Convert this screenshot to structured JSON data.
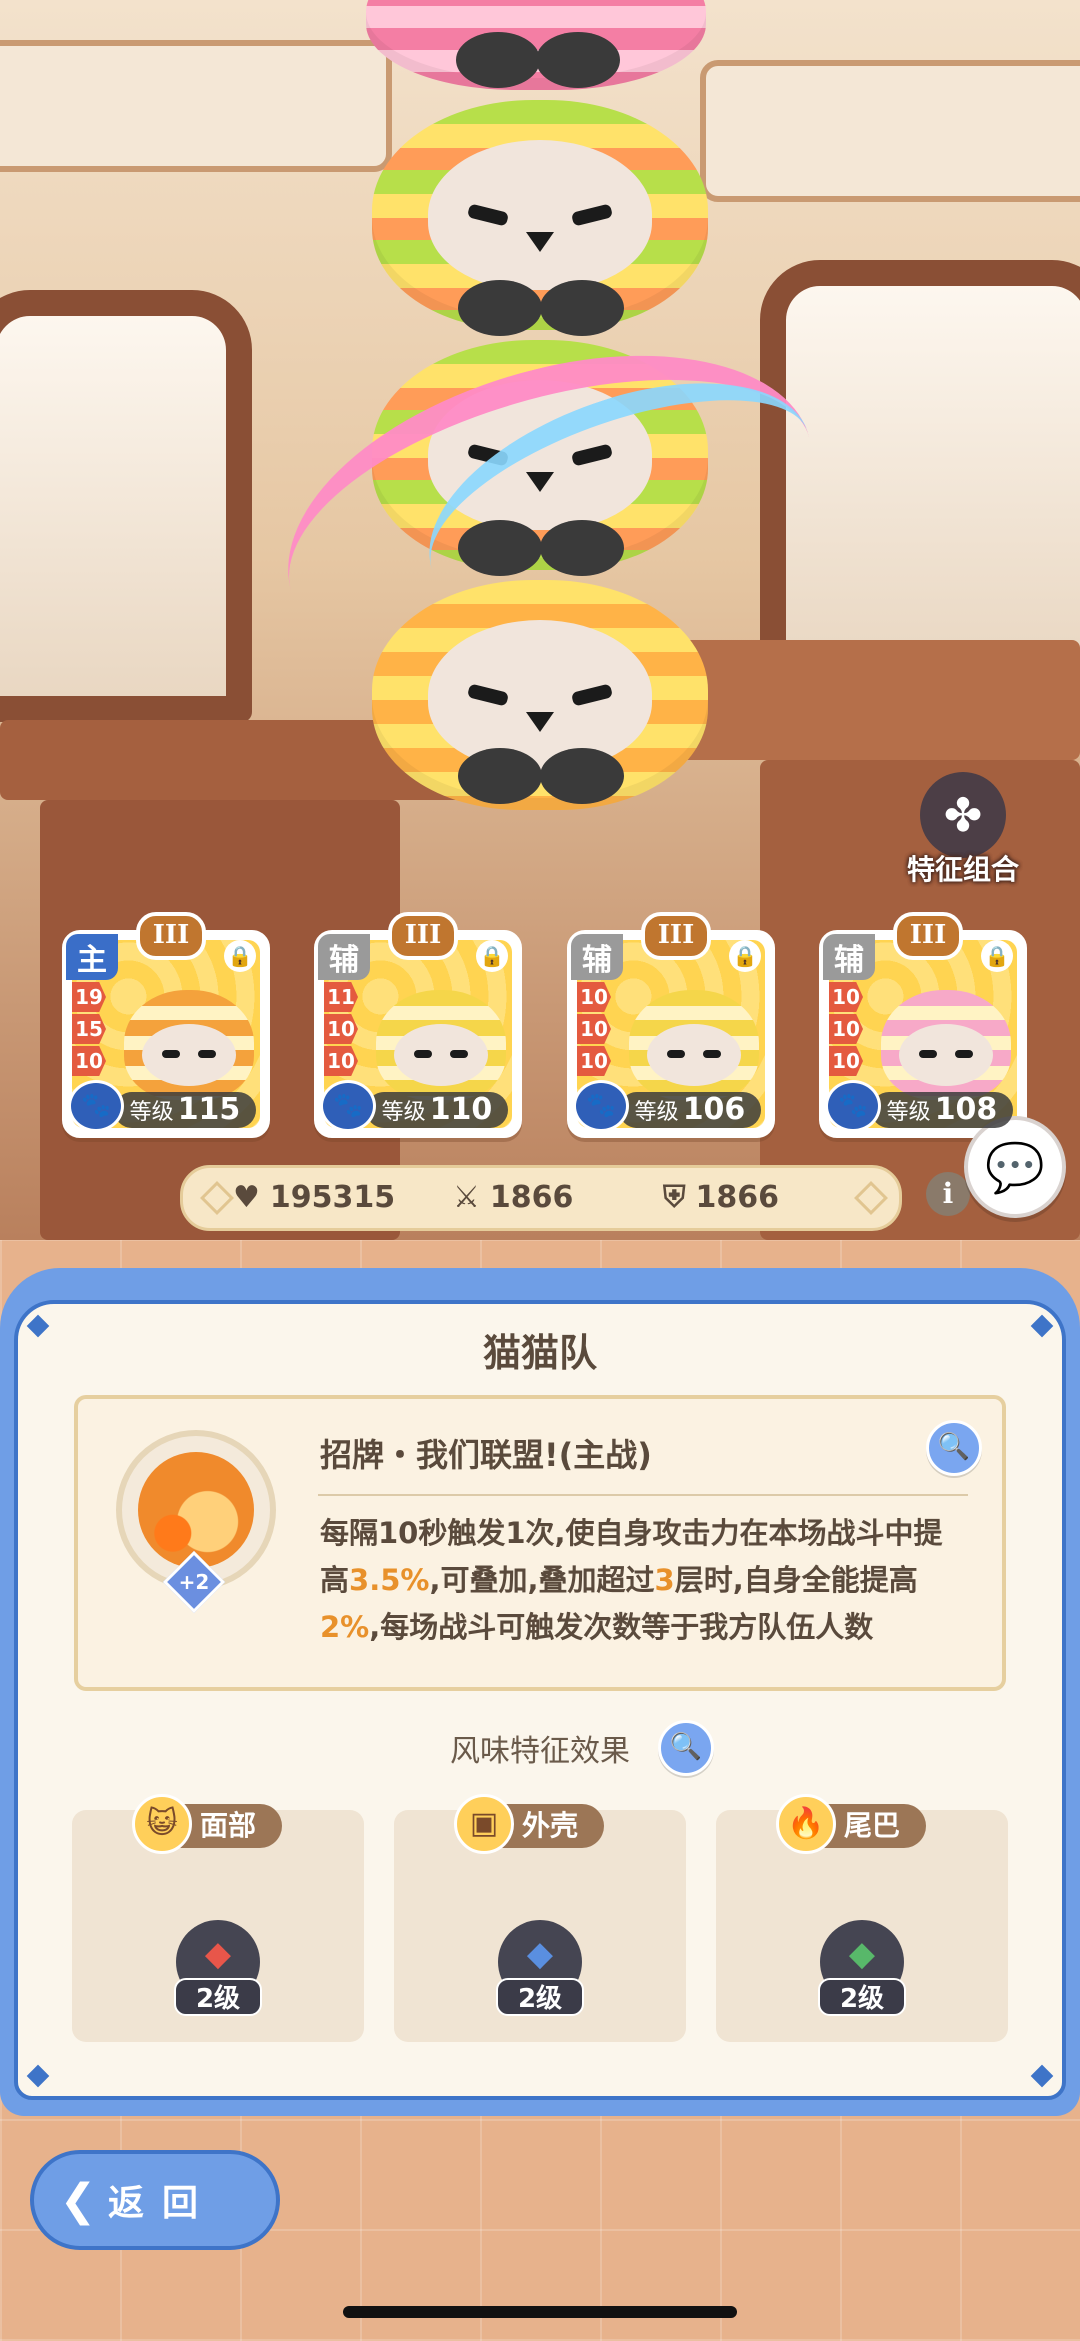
{
  "trait_combo": {
    "label": "特征组合",
    "icon": "clover-icon"
  },
  "cards": [
    {
      "role": "主",
      "role_color": "#3a6ec8",
      "rank": "III",
      "stats": [
        "19",
        "15",
        "10"
      ],
      "level_label": "等级",
      "level": "115",
      "body_color": "#f4a23c"
    },
    {
      "role": "辅",
      "role_color": "#9a9a9a",
      "rank": "III",
      "stats": [
        "11",
        "10",
        "10"
      ],
      "level_label": "等级",
      "level": "110",
      "body_color": "#f5d64a"
    },
    {
      "role": "辅",
      "role_color": "#9a9a9a",
      "rank": "III",
      "stats": [
        "10",
        "10",
        "10"
      ],
      "level_label": "等级",
      "level": "106",
      "body_color": "#f5d64a"
    },
    {
      "role": "辅",
      "role_color": "#9a9a9a",
      "rank": "III",
      "stats": [
        "10",
        "10",
        "10"
      ],
      "level_label": "等级",
      "level": "108",
      "body_color": "#f7a9c8"
    }
  ],
  "stats": {
    "hp": "195315",
    "attack": "1866",
    "defense": "1866"
  },
  "panel": {
    "title": "猫猫队",
    "skill": {
      "name": "招牌・我们联盟!(主战)",
      "plus": "+2",
      "desc_parts": [
        "每隔10秒触发1次,使自身攻击力在本场战斗中提高",
        "3.5%",
        ",可叠加,叠加超过",
        "3",
        "层时,自身全能提高",
        "2%",
        ",每场战斗可触发次数等于我方队伍人数"
      ]
    },
    "flavor_title": "风味特征效果",
    "traits": [
      {
        "label": "面部",
        "icon": "cat-face-icon",
        "level": "2级",
        "gem_color": "#e8564a"
      },
      {
        "label": "外壳",
        "icon": "shell-icon",
        "level": "2级",
        "gem_color": "#5a8fe0"
      },
      {
        "label": "尾巴",
        "icon": "tail-icon",
        "level": "2级",
        "gem_color": "#58b86a"
      }
    ]
  },
  "back": {
    "label": "返回"
  },
  "colors": {
    "accent_blue": "#3e74c8",
    "highlight": "#e8912b"
  }
}
